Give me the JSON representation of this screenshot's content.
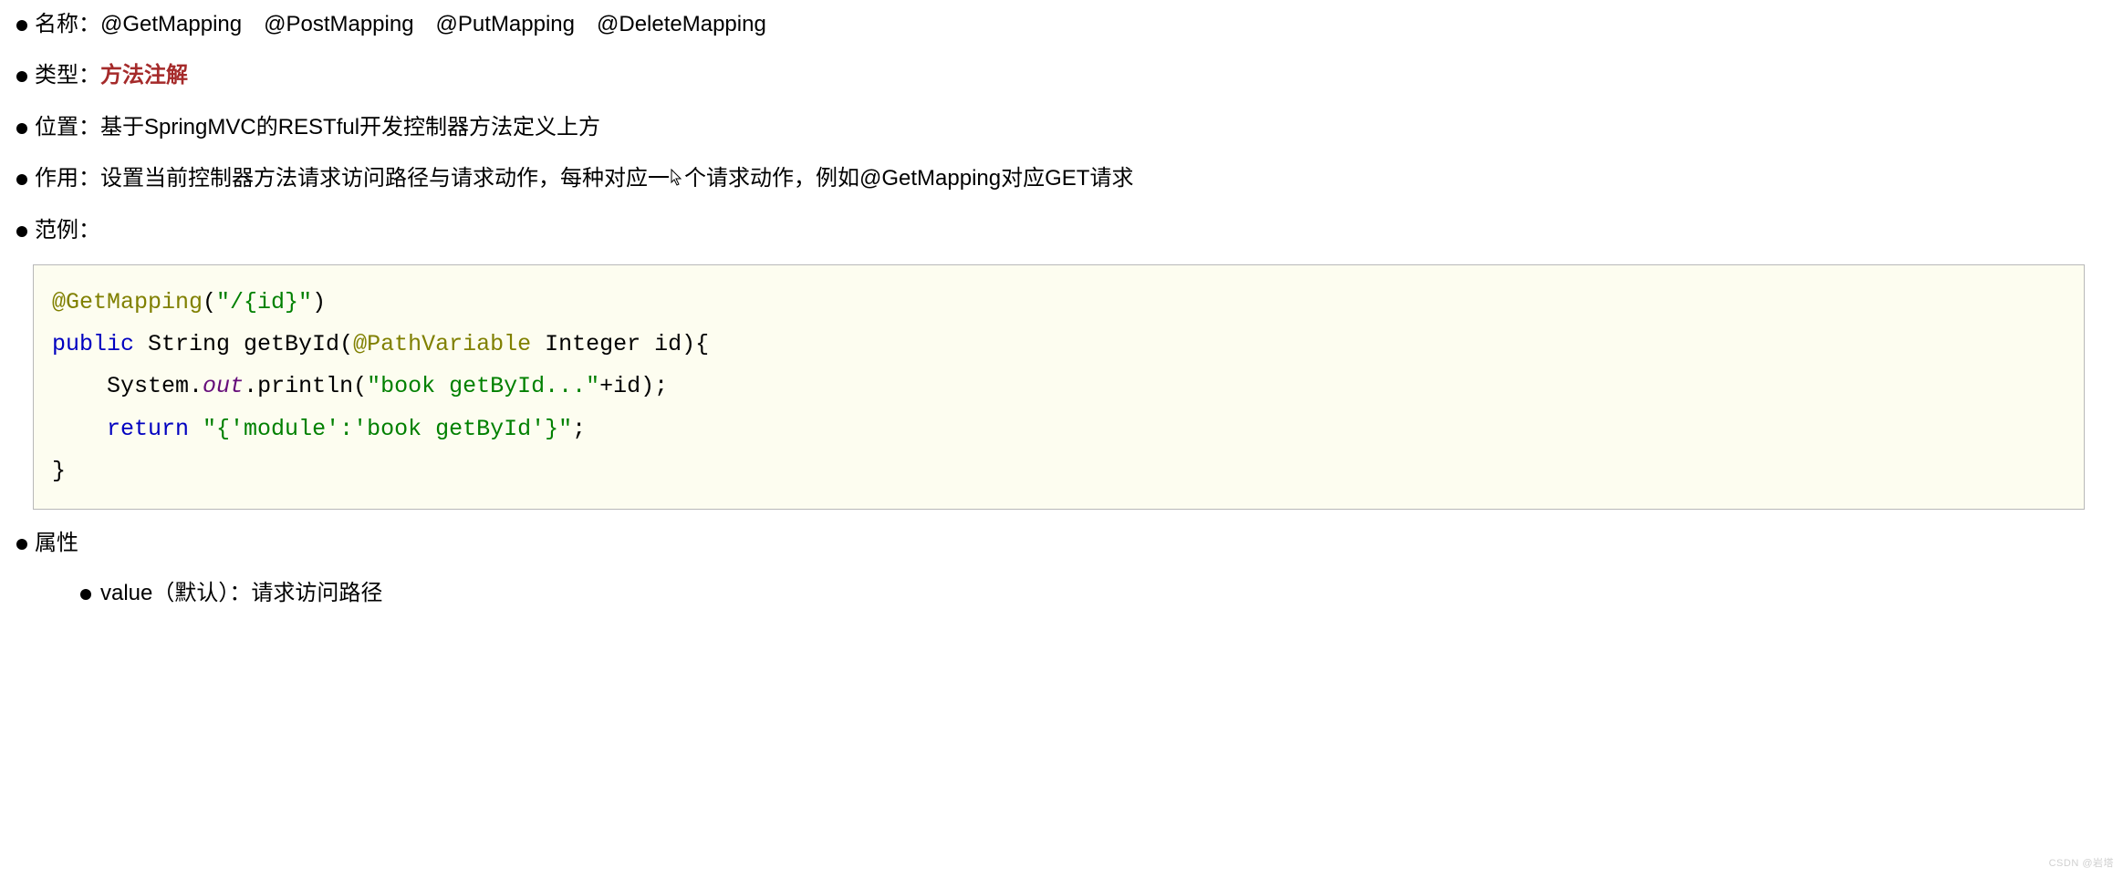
{
  "items": {
    "name": {
      "label": "名称：",
      "value": "@GetMapping　@PostMapping　@PutMapping　@DeleteMapping"
    },
    "type": {
      "label": "类型：",
      "value": "方法注解"
    },
    "position": {
      "label": "位置：",
      "value": "基于SpringMVC的RESTful开发控制器方法定义上方"
    },
    "effect_label": "作用：",
    "effect_part1": "设置当前控制器方法请求访问路径与请求动作，每种对应一",
    "effect_part2": "个请求动作，例如@GetMapping对应GET请求",
    "example": {
      "label": "范例："
    },
    "attribute": {
      "label": "属性"
    },
    "sub_attribute": "value（默认）：请求访问路径"
  },
  "code": {
    "annotation": "@GetMapping",
    "ann_arg_open": "(",
    "ann_arg_str": "\"/{id}\"",
    "ann_arg_close": ")",
    "kw_public": "public",
    "ret_type": " String ",
    "method_name": "getById",
    "sig_open": "(",
    "path_var": "@PathVariable",
    "param_rest": " Integer id){",
    "body_indent": "    ",
    "sys": "System.",
    "out": "out",
    "println_pre": ".println(",
    "println_str": "\"book getById...\"",
    "println_post": "+id);",
    "kw_return": "return",
    "return_sp": " ",
    "return_str": "\"{'module':'book getById'}\"",
    "return_end": ";",
    "close_brace": "}"
  },
  "watermark": "CSDN @岩塔"
}
